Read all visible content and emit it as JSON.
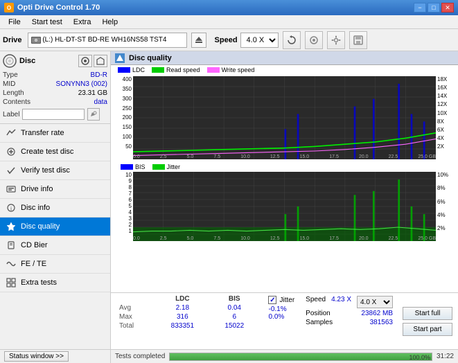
{
  "app": {
    "title": "Opti Drive Control 1.70",
    "icon_label": "O"
  },
  "title_buttons": {
    "minimize": "−",
    "maximize": "□",
    "close": "✕"
  },
  "menu": {
    "items": [
      "File",
      "Start test",
      "Extra",
      "Help"
    ]
  },
  "toolbar": {
    "drive_label": "Drive",
    "drive_value": "(L:)  HL-DT-ST BD-RE  WH16NS58 TST4",
    "speed_label": "Speed",
    "speed_value": "4.0 X"
  },
  "disc": {
    "section_title": "Disc",
    "type_label": "Type",
    "type_value": "BD-R",
    "mid_label": "MID",
    "mid_value": "SONYNN3 (002)",
    "length_label": "Length",
    "length_value": "23.31 GB",
    "contents_label": "Contents",
    "contents_value": "data",
    "label_label": "Label",
    "label_value": ""
  },
  "nav_items": [
    {
      "id": "transfer-rate",
      "label": "Transfer rate",
      "icon": "→"
    },
    {
      "id": "create-test-disc",
      "label": "Create test disc",
      "icon": "+"
    },
    {
      "id": "verify-test-disc",
      "label": "Verify test disc",
      "icon": "✓"
    },
    {
      "id": "drive-info",
      "label": "Drive info",
      "icon": "i"
    },
    {
      "id": "disc-info",
      "label": "Disc info",
      "icon": "📄"
    },
    {
      "id": "disc-quality",
      "label": "Disc quality",
      "icon": "★",
      "active": true
    },
    {
      "id": "cd-bier",
      "label": "CD Bier",
      "icon": "🍺"
    },
    {
      "id": "fe-te",
      "label": "FE / TE",
      "icon": "~"
    },
    {
      "id": "extra-tests",
      "label": "Extra tests",
      "icon": "+"
    }
  ],
  "status_window": {
    "label": "Status window >>"
  },
  "chart": {
    "title": "Disc quality",
    "legend": [
      {
        "id": "ldc",
        "label": "LDC",
        "color": "#0000ff"
      },
      {
        "id": "read-speed",
        "label": "Read speed",
        "color": "#00cc00"
      },
      {
        "id": "write-speed",
        "label": "Write speed",
        "color": "#ff66ff"
      }
    ],
    "legend2": [
      {
        "id": "bis",
        "label": "BIS",
        "color": "#0000ff"
      },
      {
        "id": "jitter",
        "label": "Jitter",
        "color": "#00cc00"
      }
    ],
    "chart1": {
      "y_left": [
        "400",
        "350",
        "300",
        "250",
        "200",
        "150",
        "100",
        "50"
      ],
      "y_right": [
        "18X",
        "16X",
        "14X",
        "12X",
        "10X",
        "8X",
        "6X",
        "4X",
        "2X"
      ],
      "x_labels": [
        "0.0",
        "2.5",
        "5.0",
        "7.5",
        "10.0",
        "12.5",
        "15.0",
        "17.5",
        "20.0",
        "22.5",
        "25.0 GB"
      ]
    },
    "chart2": {
      "y_left": [
        "10",
        "9",
        "8",
        "7",
        "6",
        "5",
        "4",
        "3",
        "2",
        "1"
      ],
      "y_right": [
        "10%",
        "8%",
        "6%",
        "4%",
        "2%"
      ],
      "x_labels": [
        "0.0",
        "2.5",
        "5.0",
        "7.5",
        "10.0",
        "12.5",
        "15.0",
        "17.5",
        "20.0",
        "22.5",
        "25.0 GB"
      ]
    }
  },
  "stats": {
    "columns": [
      "LDC",
      "BIS"
    ],
    "jitter_label": "Jitter",
    "jitter_checked": true,
    "rows": [
      {
        "label": "Avg",
        "ldc": "2.18",
        "bis": "0.04",
        "jitter": "-0.1%"
      },
      {
        "label": "Max",
        "ldc": "316",
        "bis": "6",
        "jitter": "0.0%"
      },
      {
        "label": "Total",
        "ldc": "833351",
        "bis": "15022",
        "jitter": ""
      }
    ],
    "speed_label": "Speed",
    "speed_value": "4.23 X",
    "speed_select": "4.0 X",
    "position_label": "Position",
    "position_value": "23862 MB",
    "samples_label": "Samples",
    "samples_value": "381563"
  },
  "buttons": {
    "start_full": "Start full",
    "start_part": "Start part"
  },
  "bottom_bar": {
    "status_text": "Tests completed",
    "progress_percent": 100,
    "progress_display": "100.0%",
    "time": "31:22"
  }
}
